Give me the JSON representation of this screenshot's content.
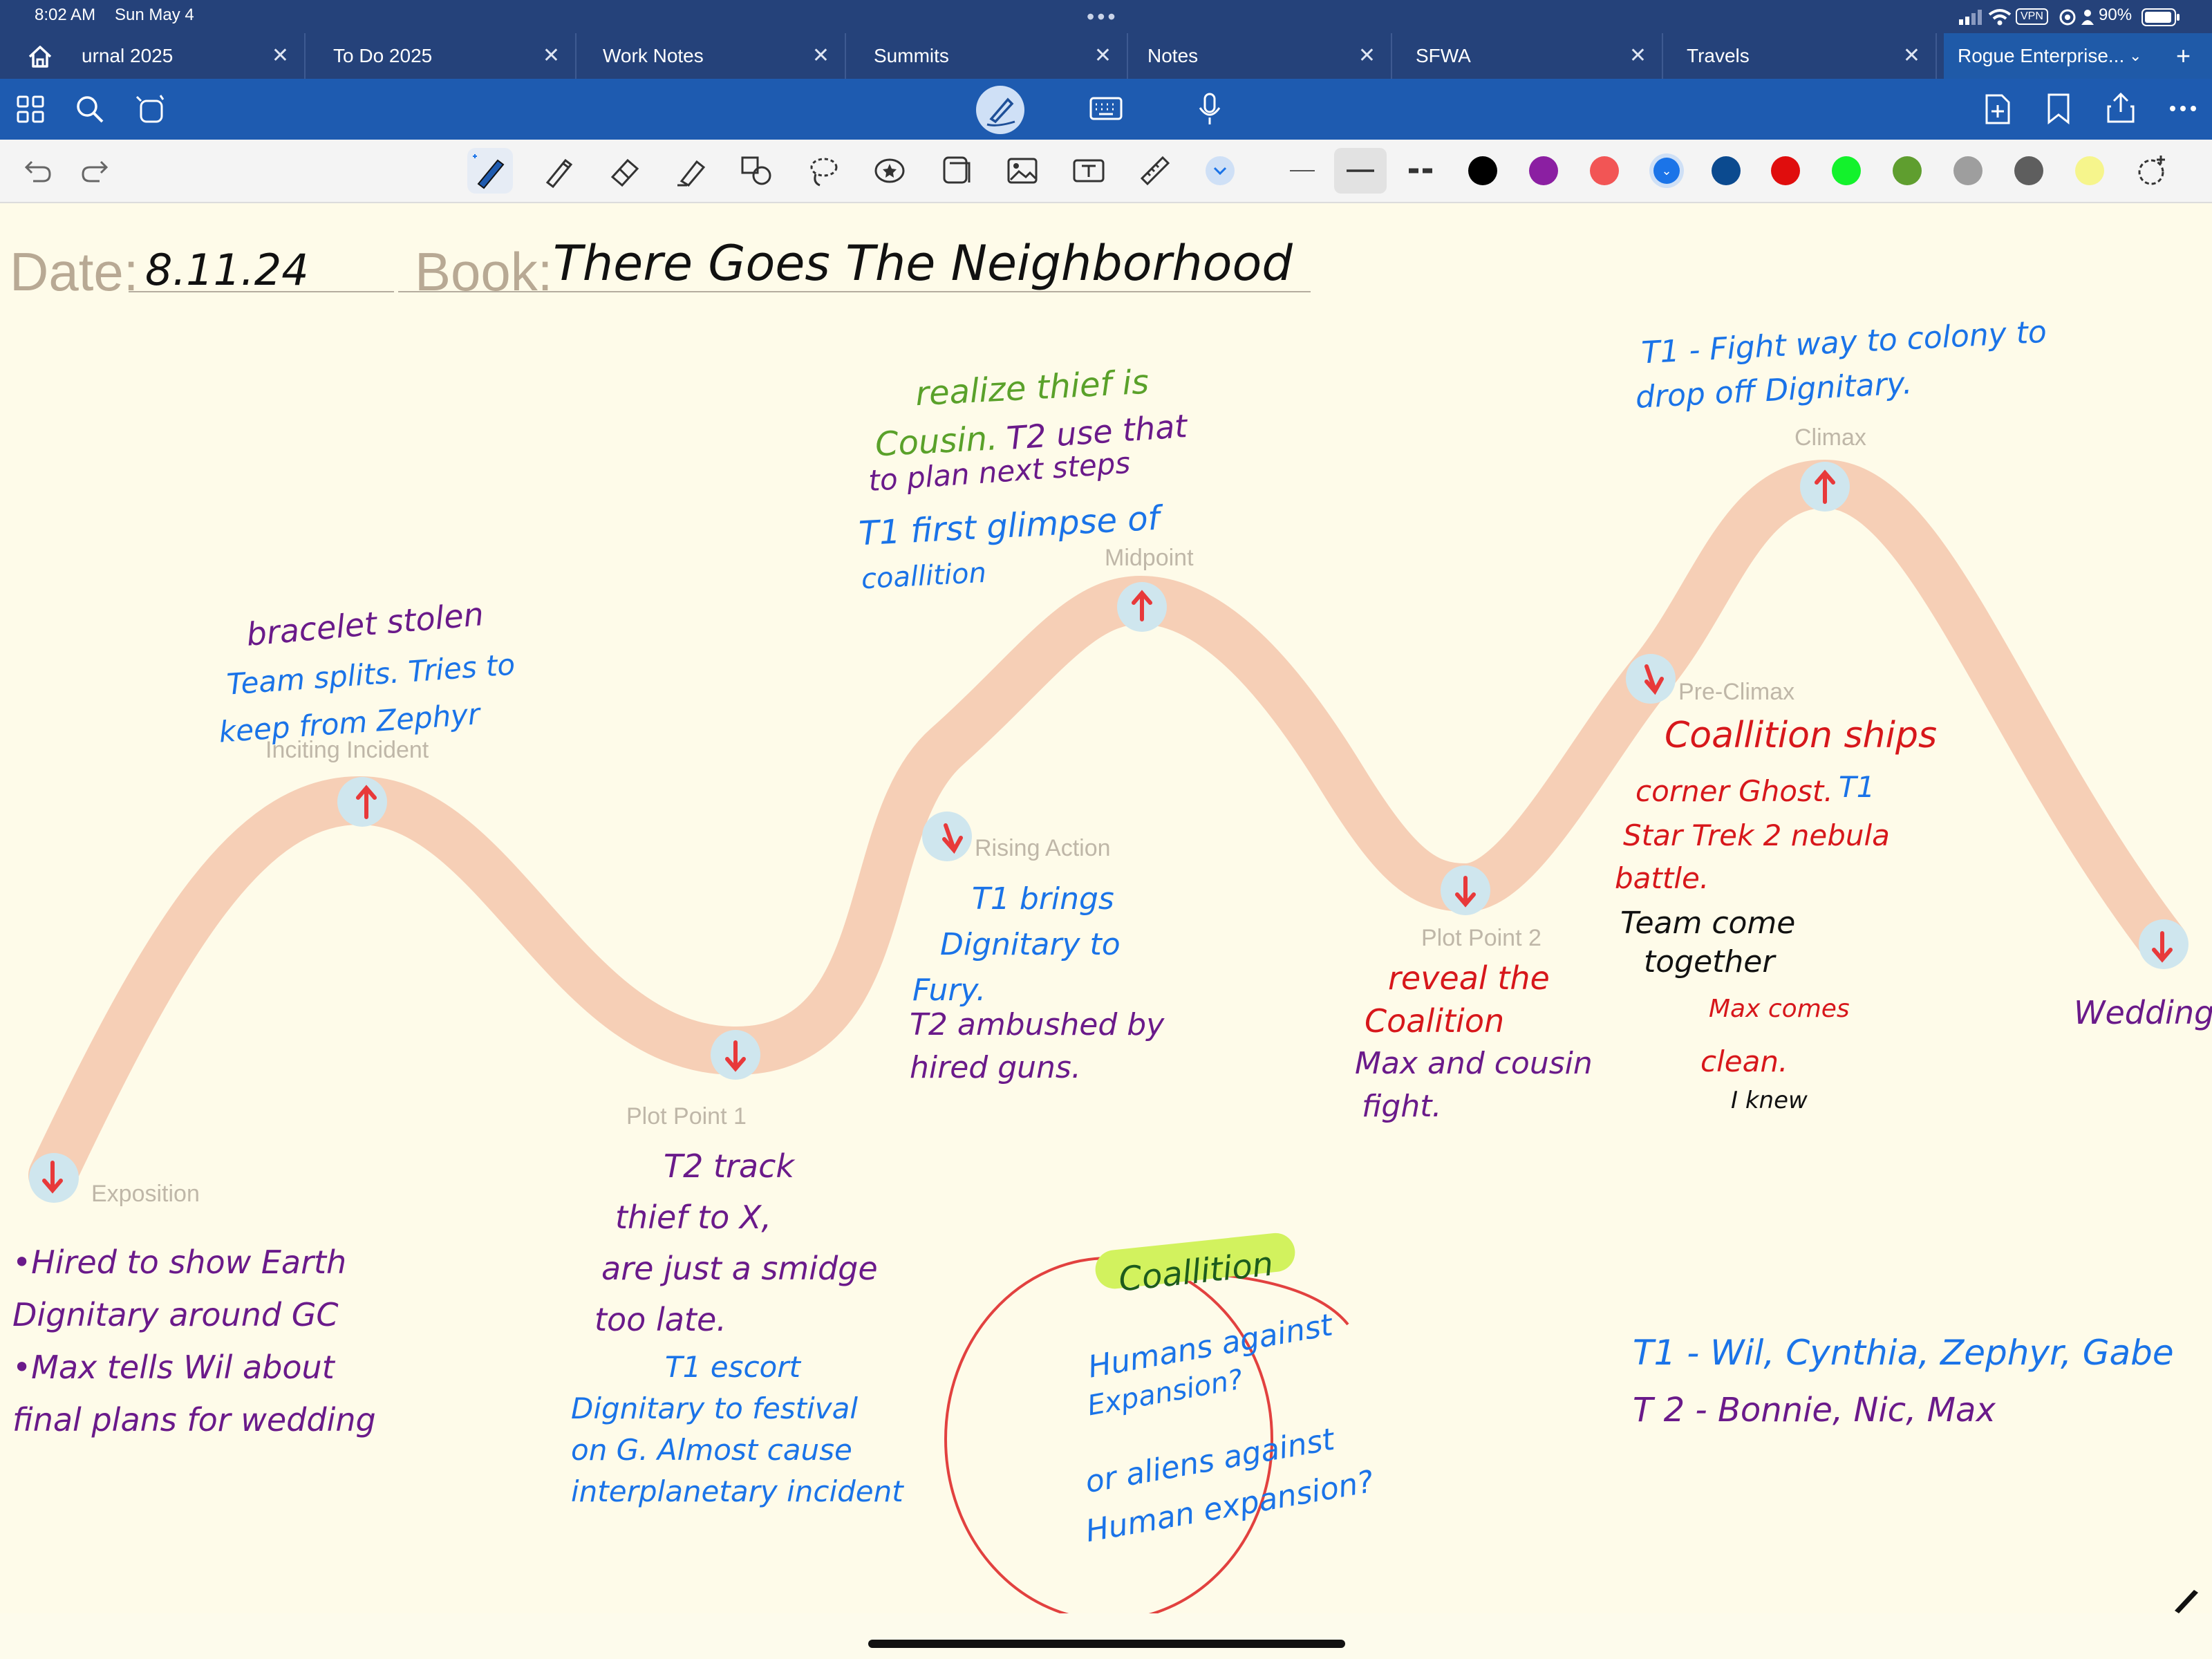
{
  "status": {
    "time": "8:02 AM",
    "date": "Sun May 4",
    "vpn": "VPN",
    "battery": "90%"
  },
  "tabs": [
    {
      "label": "urnal 2025"
    },
    {
      "label": "To Do 2025"
    },
    {
      "label": "Work Notes"
    },
    {
      "label": "Summits"
    },
    {
      "label": "Notes"
    },
    {
      "label": "SFWA"
    },
    {
      "label": "Travels"
    },
    {
      "label": "Rogue Enterprise..."
    }
  ],
  "colors": {
    "status_bg": "#25427a",
    "toolbar_bg": "#1e5bb0",
    "wave": "#f4c7ad",
    "node": "#cfe6ee",
    "arrow": "#e8393a",
    "circle": "#e2413f",
    "highlight": "#d2f25e",
    "swatches": [
      "#000000",
      "#8b1fa2",
      "#f25555",
      "#1b74e8",
      "#0b4a8f",
      "#e00d0d",
      "#13f22c",
      "#5f9e2f",
      "#9e9e9e",
      "#5e5e5e",
      "#f6f58c"
    ]
  },
  "header": {
    "date_label": "Date:",
    "date_value": "8.11.24",
    "book_label": "Book:",
    "book_value": "There Goes The Neighborhood"
  },
  "plot_labels": {
    "exposition": "Exposition",
    "inciting": "Inciting Incident",
    "pp1": "Plot Point 1",
    "rising": "Rising Action",
    "midpoint": "Midpoint",
    "pp2": "Plot Point 2",
    "preclimax": "Pre-Climax",
    "climax": "Climax"
  },
  "notes": {
    "exposition": [
      "•Hired to show Earth",
      "Dignitary around GC",
      "•Max tells Wil about",
      "final plans for wedding"
    ],
    "inciting": [
      "bracelet stolen"
    ],
    "inciting_blue": [
      "Team splits. Tries to",
      "keep from Zephyr"
    ],
    "pp1": [
      "T2  track",
      "thief to X,",
      "are just a smidge",
      "too late."
    ],
    "pp1_blue": [
      "T1  escort",
      "Dignitary to festival",
      "on G. Almost cause",
      "interplanetary incident"
    ],
    "rising_blue": [
      "T1 brings",
      "Dignitary  to",
      "Fury."
    ],
    "rising_purple": [
      "T2  ambushed by",
      "hired  guns."
    ],
    "midpoint_green": [
      "realize thief is",
      "Cousin."
    ],
    "midpoint_purple_inline": "T2  use that",
    "midpoint_purple": [
      "to plan next steps"
    ],
    "midpoint_blue": [
      "T1 first glimpse of",
      "coallition"
    ],
    "climax_blue": [
      "T1 - Fight way to colony to",
      "drop off Dignitary."
    ],
    "preclimax_red": [
      "Coallition ships",
      "corner Ghost."
    ],
    "preclimax_blue_inline": "T1",
    "preclimax_red2": [
      "Star Trek 2 nebula",
      "battle."
    ],
    "preclimax_black": [
      "Team come",
      "together"
    ],
    "preclimax_red3": [
      "Max comes",
      "clean."
    ],
    "preclimax_black2": "I knew",
    "pp2_red": [
      "reveal the",
      "Coalition"
    ],
    "pp2_purple": [
      "Max and cousin",
      "fight."
    ],
    "wedding": "Wedding",
    "coalition_title": "Coallition",
    "coalition_lines": [
      "Humans against",
      "Expansion?",
      "or aliens against",
      "Human expansion?"
    ],
    "team1": "T1 - Wil, Cynthia, Zephyr, Gabe",
    "team2": "T 2 - Bonnie, Nic, Max"
  }
}
